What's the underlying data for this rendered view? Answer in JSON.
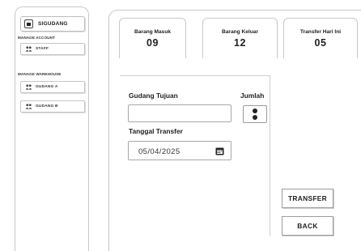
{
  "sidebar": {
    "app_name": "SIGUDANG",
    "manage_account_label": "MANAGE ACCOUNT",
    "staff_label": "STAFF",
    "manage_warehouse_label": "MANAGE WAREHOUSE",
    "gudang_a_label": "GUDANG A",
    "gudang_b_label": "GUDANG B"
  },
  "stats": {
    "masuk": {
      "label": "Barang Masuk",
      "value": "09"
    },
    "keluar": {
      "label": "Barang Keluar",
      "value": "12"
    },
    "transfer": {
      "label": "Transfer Hari Ini",
      "value": "05"
    }
  },
  "form": {
    "gudang_tujuan_label": "Gudang Tujuan",
    "gudang_tujuan_value": "",
    "jumlah_label": "Jumlah",
    "tanggal_label": "Tanggal Transfer",
    "tanggal_value": "05/04/2025"
  },
  "buttons": {
    "transfer": "TRANSFER",
    "back": "BACK"
  },
  "icons": {
    "logo": "warehouse-icon",
    "staff": "users-icon",
    "gudang": "users-icon",
    "calendar": "calendar-icon"
  }
}
